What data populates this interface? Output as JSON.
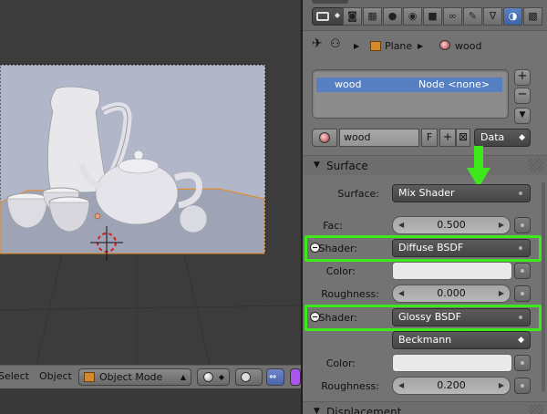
{
  "viewport": {
    "header": {
      "menus": [
        "Select",
        "Object"
      ],
      "mode": "Object Mode"
    },
    "colors": {
      "background": "#3c3c3c",
      "selection_outline": "#e88a1a",
      "grid": "#2e2e2e"
    }
  },
  "properties": {
    "active_tab": "material-tab",
    "tabs": [
      "render-tab",
      "render-layers-tab",
      "scene-tab",
      "world-tab",
      "object-tab",
      "constraints-tab",
      "modifiers-tab",
      "data-tab",
      "material-tab",
      "texture-tab",
      "particles-tab"
    ],
    "breadcrumb": {
      "object": "Plane",
      "material": "wood"
    },
    "material_slots": [
      {
        "name": "wood",
        "node": "Node <none>"
      }
    ],
    "material_id": {
      "name": "wood",
      "fake_user": "F",
      "link": "Data"
    },
    "surface": {
      "title": "Surface",
      "surface_label": "Surface:",
      "surface_value": "Mix Shader",
      "fac_label": "Fac:",
      "fac_value": "0.500",
      "shader1": {
        "label": "Shader:",
        "value": "Diffuse BSDF",
        "color_label": "Color:",
        "color": "#e9e9e9",
        "roughness_label": "Roughness:",
        "roughness": "0.000"
      },
      "shader2": {
        "label": "Shader:",
        "value": "Glossy BSDF",
        "distribution": "Beckmann",
        "color_label": "Color:",
        "color": "#e9e9e9",
        "roughness_label": "Roughness:",
        "roughness": "0.200"
      }
    },
    "displacement": {
      "title": "Displacement"
    },
    "colors": {
      "highlight": "#3fe81a",
      "active_tab": "#4a70b6",
      "slot_selection": "#5680c2",
      "arrow": "#3fe81a"
    }
  }
}
